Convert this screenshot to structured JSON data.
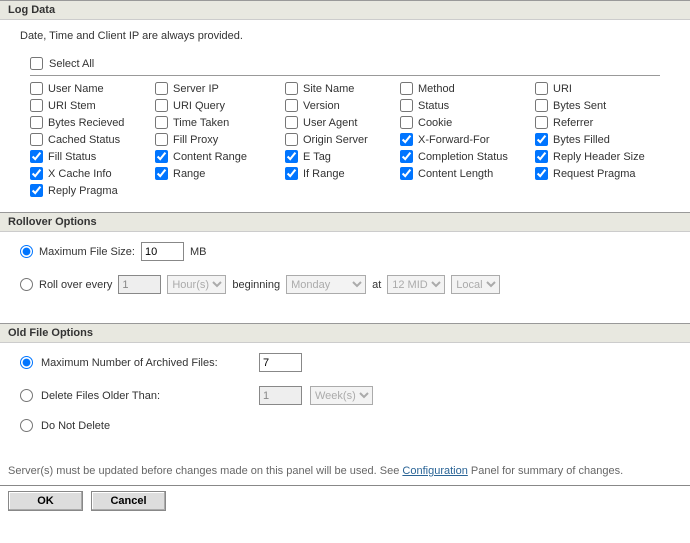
{
  "sections": {
    "logData": "Log Data",
    "rollover": "Rollover Options",
    "oldFile": "Old File Options"
  },
  "intro": "Date, Time and Client IP are always provided.",
  "selectAll": "Select All",
  "fields": [
    {
      "label": "User Name",
      "checked": false
    },
    {
      "label": "Server IP",
      "checked": false
    },
    {
      "label": "Site Name",
      "checked": false
    },
    {
      "label": "Method",
      "checked": false
    },
    {
      "label": "URI",
      "checked": false
    },
    {
      "label": "URI Stem",
      "checked": false
    },
    {
      "label": "URI Query",
      "checked": false
    },
    {
      "label": "Version",
      "checked": false
    },
    {
      "label": "Status",
      "checked": false
    },
    {
      "label": "Bytes Sent",
      "checked": false
    },
    {
      "label": "Bytes Recieved",
      "checked": false
    },
    {
      "label": "Time Taken",
      "checked": false
    },
    {
      "label": "User Agent",
      "checked": false
    },
    {
      "label": "Cookie",
      "checked": false
    },
    {
      "label": "Referrer",
      "checked": false
    },
    {
      "label": "Cached Status",
      "checked": false
    },
    {
      "label": "Fill Proxy",
      "checked": false
    },
    {
      "label": "Origin Server",
      "checked": false
    },
    {
      "label": "X-Forward-For",
      "checked": true
    },
    {
      "label": "Bytes Filled",
      "checked": true
    },
    {
      "label": "Fill Status",
      "checked": true
    },
    {
      "label": "Content Range",
      "checked": true
    },
    {
      "label": "E Tag",
      "checked": true
    },
    {
      "label": "Completion Status",
      "checked": true
    },
    {
      "label": "Reply Header Size",
      "checked": true
    },
    {
      "label": "X Cache Info",
      "checked": true
    },
    {
      "label": "Range",
      "checked": true
    },
    {
      "label": "If Range",
      "checked": true
    },
    {
      "label": "Content Length",
      "checked": true
    },
    {
      "label": "Request Pragma",
      "checked": true
    },
    {
      "label": "Reply Pragma",
      "checked": true
    }
  ],
  "rollover": {
    "maxSizeLabel": "Maximum File Size:",
    "maxSizeValue": "10",
    "maxSizeUnit": "MB",
    "everyLabel": "Roll over every",
    "everyValue": "1",
    "everyUnit": "Hour(s)",
    "beginning": "beginning",
    "beginDay": "Monday",
    "at": "at",
    "atTime": "12 MID",
    "tz": "Local"
  },
  "oldFile": {
    "maxArchLabel": "Maximum Number of Archived Files:",
    "maxArchValue": "7",
    "deleteOlderLabel": "Delete Files Older Than:",
    "deleteOlderValue": "1",
    "deleteOlderUnit": "Week(s)",
    "doNotDelete": "Do Not Delete"
  },
  "notice": {
    "pre": "Server(s) must be updated before changes made on this panel will be used. See ",
    "link": "Configuration",
    "post": " Panel for summary of changes."
  },
  "buttons": {
    "ok": "OK",
    "cancel": "Cancel"
  }
}
